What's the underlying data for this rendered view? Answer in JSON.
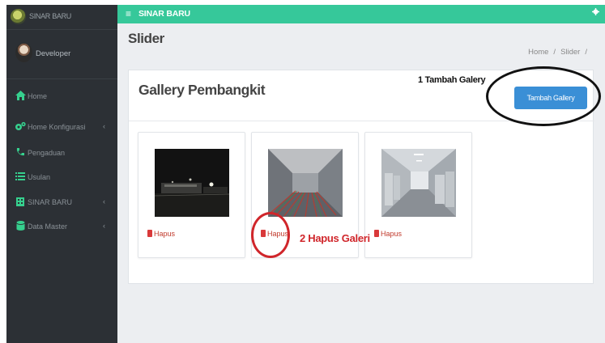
{
  "brand": {
    "name": "SINAR BARU"
  },
  "user": {
    "name": "Developer"
  },
  "sidebar": {
    "items": [
      {
        "label": "Home",
        "icon": "home-icon",
        "has_children": false
      },
      {
        "label": "Home Konfigurasi",
        "icon": "gears-icon",
        "has_children": true
      },
      {
        "label": "Pengaduan",
        "icon": "phone-icon",
        "has_children": false
      },
      {
        "label": "Usulan",
        "icon": "list-icon",
        "has_children": false
      },
      {
        "label": "SINAR BARU",
        "icon": "building-icon",
        "has_children": true
      },
      {
        "label": "Data Master",
        "icon": "database-icon",
        "has_children": true
      }
    ]
  },
  "topbar": {
    "title": "SINAR BARU",
    "menu_icon": "hamburger-icon",
    "settings_icon": "gear-icon"
  },
  "page": {
    "title": "Slider",
    "breadcrumb": {
      "home": "Home",
      "sep": "/",
      "current": "Slider",
      "trail_sep": "/"
    }
  },
  "gallery": {
    "title": "Gallery Pembangkit",
    "add_button": "Tambah Gallery",
    "items": [
      {
        "delete_label": "Hapus"
      },
      {
        "delete_label": "Hapus"
      },
      {
        "delete_label": "Hapus"
      }
    ]
  },
  "annotations": {
    "step1": "1 Tambah Galery",
    "step2": "2 Hapus Galeri"
  },
  "colors": {
    "topbar": "#36c89a",
    "sidebar": "#2c3035",
    "button": "#3a8fd6",
    "delete": "#d9393a",
    "annotation_red": "#d0262b"
  }
}
